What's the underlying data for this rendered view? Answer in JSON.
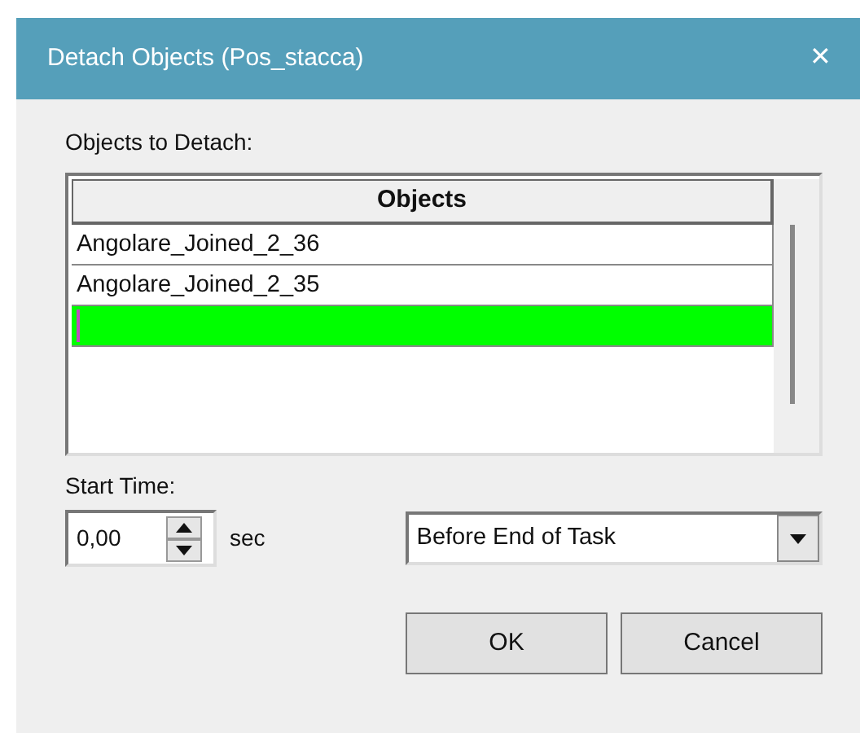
{
  "window": {
    "title": "Detach Objects (Pos_stacca)",
    "close": "✕"
  },
  "objects_label": "Objects to Detach:",
  "table": {
    "columns": [
      "Objects"
    ],
    "rows": [
      {
        "text": "Angolare_Joined_2_36",
        "selected": false
      },
      {
        "text": "Angolare_Joined_2_35",
        "selected": false
      },
      {
        "selected": true
      }
    ]
  },
  "start_time": {
    "label": "Start Time:",
    "value": "0,00",
    "unit": "sec",
    "mode": "Before End of Task"
  },
  "buttons": [
    "OK",
    "Cancel"
  ]
}
